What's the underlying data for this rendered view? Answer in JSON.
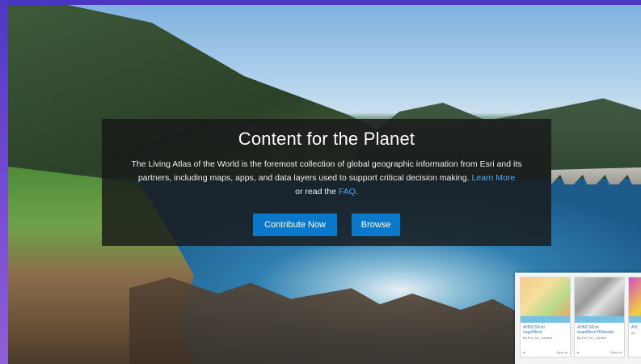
{
  "hero": {
    "title": "Content for the Planet",
    "description": "The Living Atlas of the World is the foremost collection of global geographic information from Esri and its partners, including maps, apps, and data layers used to support critical decision making.",
    "learn_more_link": "Learn More",
    "or_read_the": "or read the",
    "faq_link": "FAQ",
    "period": "."
  },
  "buttons": {
    "contribute": "Contribute Now",
    "browse": "Browse"
  },
  "preview_cards": [
    {
      "title": "AHN2 50cm",
      "subtitle": "ongefilterd",
      "by": "By Esri_NL_Content",
      "open": "Open in"
    },
    {
      "title": "AHN2 50cm",
      "subtitle": "ongefilterd Hillshade",
      "by": "By Esri_NL_Content",
      "open": "Open in"
    },
    {
      "title": "AH",
      "subtitle": "",
      "by": "By",
      "open": ""
    }
  ],
  "colors": {
    "button_blue": "#0a79c9",
    "link_blue": "#4fa9ff",
    "frame_purple": "#5a3fc9"
  }
}
